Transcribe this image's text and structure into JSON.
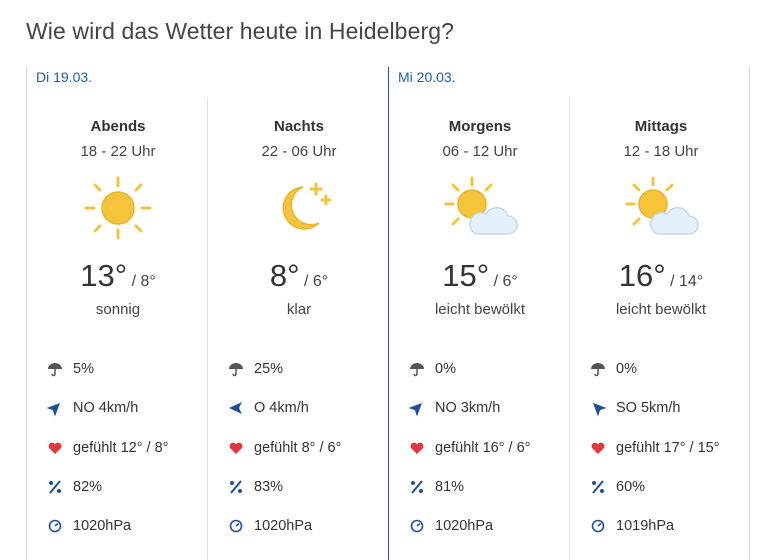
{
  "title": "Wie wird das Wetter heute in Heidelberg?",
  "days": [
    {
      "label": "Di 19.03."
    },
    {
      "label": "Mi 20.03."
    }
  ],
  "columns": [
    {
      "period": "Abends",
      "hours": "18 - 22 Uhr",
      "icon": "sun-icon",
      "temp_high": "13°",
      "temp_low": "8°",
      "condition": "sonnig",
      "rain": "5%",
      "wind": "NO 4km/h",
      "wind_direction": "NO",
      "feels": "gefühlt 12° / 8°",
      "humidity": "82%",
      "pressure": "1020hPa"
    },
    {
      "period": "Nachts",
      "hours": "22 - 06 Uhr",
      "icon": "moon-stars-icon",
      "temp_high": "8°",
      "temp_low": "6°",
      "condition": "klar",
      "rain": "25%",
      "wind": "O 4km/h",
      "wind_direction": "O",
      "feels": "gefühlt 8° / 6°",
      "humidity": "83%",
      "pressure": "1020hPa"
    },
    {
      "period": "Morgens",
      "hours": "06 - 12 Uhr",
      "icon": "partly-cloudy-icon",
      "temp_high": "15°",
      "temp_low": "6°",
      "condition": "leicht bewölkt",
      "rain": "0%",
      "wind": "NO 3km/h",
      "wind_direction": "NO",
      "feels": "gefühlt 16° / 6°",
      "humidity": "81%",
      "pressure": "1020hPa"
    },
    {
      "period": "Mittags",
      "hours": "12 - 18 Uhr",
      "icon": "partly-cloudy-icon",
      "temp_high": "16°",
      "temp_low": "14°",
      "condition": "leicht bewölkt",
      "rain": "0%",
      "wind": "SO 5km/h",
      "wind_direction": "SO",
      "feels": "gefühlt 17° / 15°",
      "humidity": "60%",
      "pressure": "1019hPa"
    }
  ],
  "temp_separator": "/",
  "colors": {
    "accent": "#1f5fae",
    "strong_divider": "#1f4f9c",
    "sun": "#f6c43a",
    "heart": "#e0383d",
    "cloud": "#e4f0fa"
  }
}
